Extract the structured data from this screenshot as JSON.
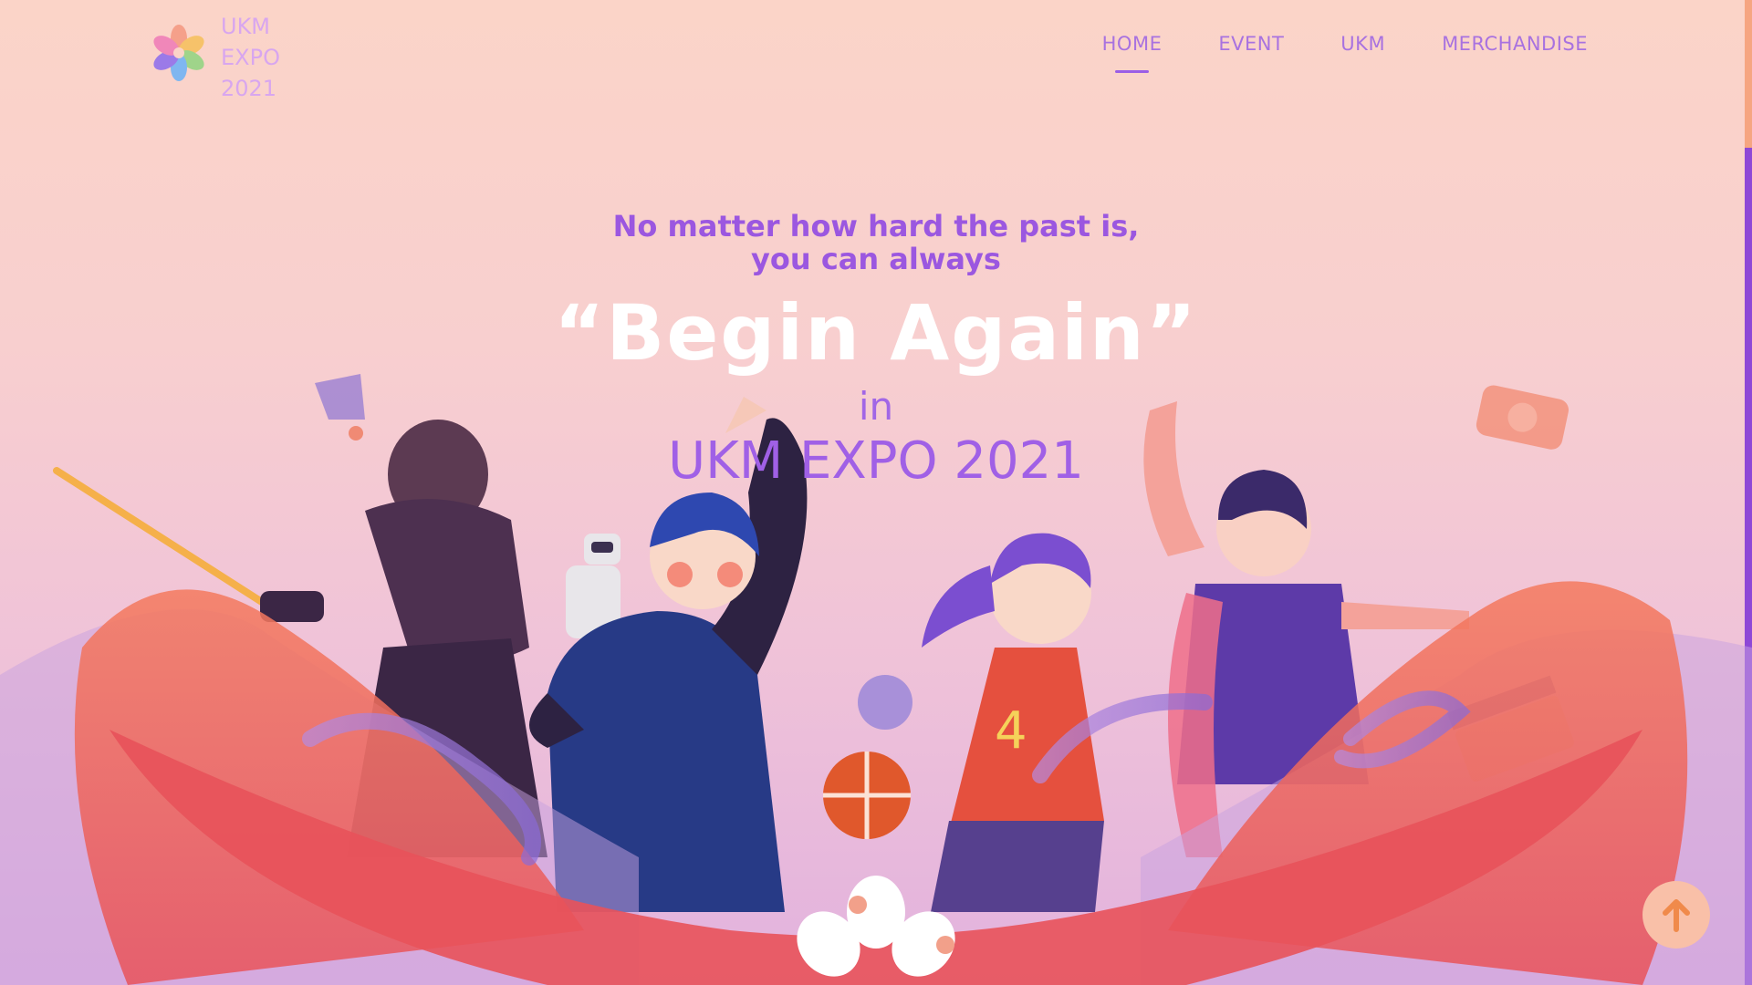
{
  "logo": {
    "lines": [
      "UKM",
      "EXPO",
      "2021"
    ]
  },
  "nav": [
    {
      "label": "HOME",
      "active": true
    },
    {
      "label": "EVENT",
      "active": false
    },
    {
      "label": "UKM",
      "active": false
    },
    {
      "label": "MERCHANDISE",
      "active": false
    }
  ],
  "hero": {
    "tagline_line1": "No matter how hard the past is,",
    "tagline_line2": "you can always",
    "headline": "“Begin Again”",
    "in_text": "in",
    "event_name": "UKM EXPO 2021"
  },
  "colors": {
    "accent": "#9b57e0",
    "nav_text": "#a872e0",
    "headline": "#ffffff",
    "back_to_top": "#f9c0a8",
    "arrow": "#f08a4b"
  },
  "icons": [
    "logo-flower-icon",
    "arrow-up-icon"
  ]
}
